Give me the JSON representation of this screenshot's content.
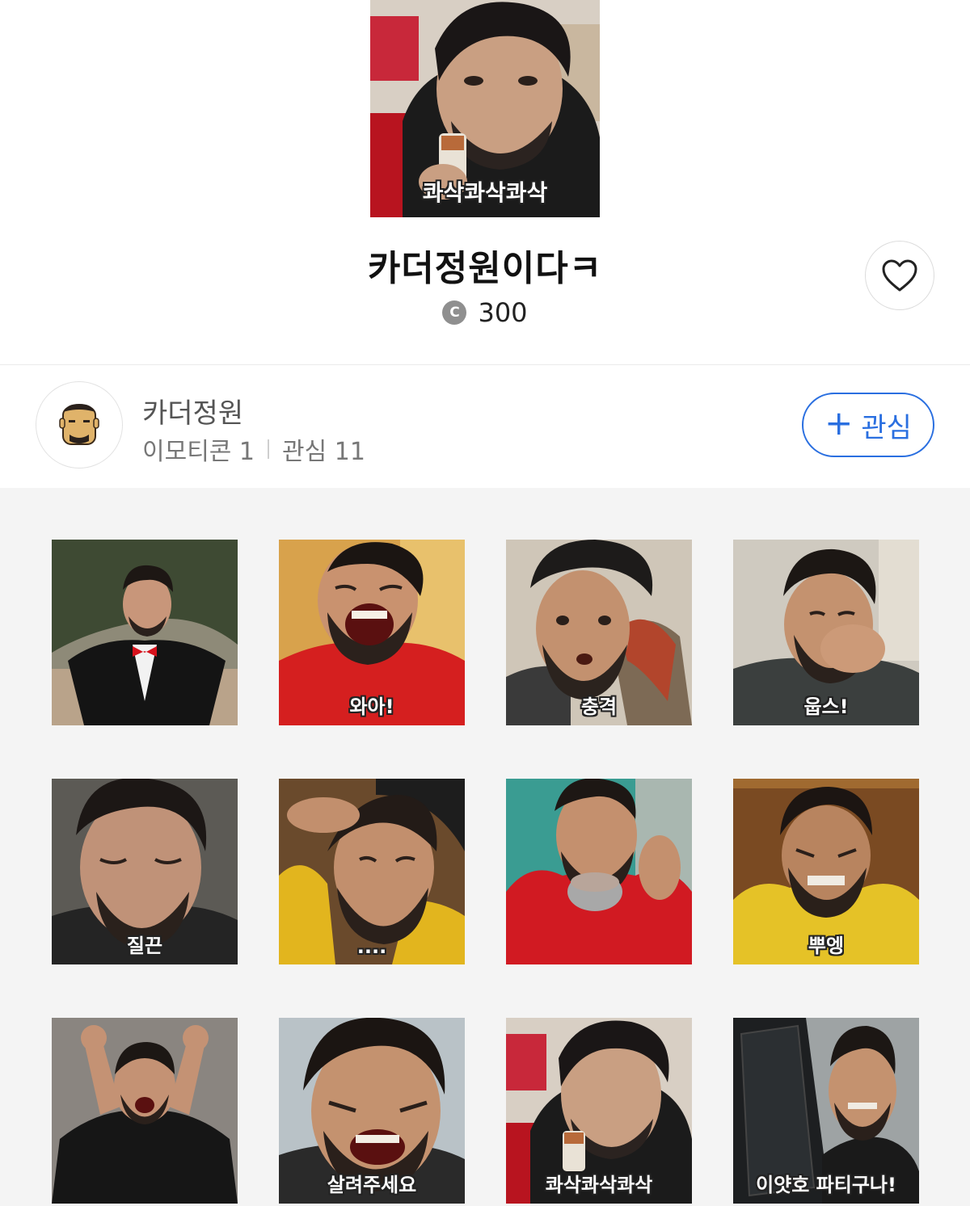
{
  "pack": {
    "hero_caption": "콰삭콰삭콰삭",
    "title": "카더정원이다ㅋ",
    "price_icon": "coin-icon",
    "price_icon_letter": "C",
    "price": "300"
  },
  "creator": {
    "name": "카더정원",
    "emoticon_stat": "이모티콘 1",
    "interest_stat": "관심 11",
    "follow_label": "관심"
  },
  "grid": [
    {
      "caption": ""
    },
    {
      "caption": "와아!"
    },
    {
      "caption": "충격"
    },
    {
      "caption": "웁스!"
    },
    {
      "caption": "질끈"
    },
    {
      "caption": "...."
    },
    {
      "caption": ""
    },
    {
      "caption": "뿌엥"
    },
    {
      "caption": ""
    },
    {
      "caption": "살려주세요"
    },
    {
      "caption": "콰삭콰삭콰삭"
    },
    {
      "caption": "이얏호 파티구나!"
    }
  ],
  "colors": {
    "accent": "#2a6fe0",
    "grid_bg": "#f4f4f4"
  }
}
